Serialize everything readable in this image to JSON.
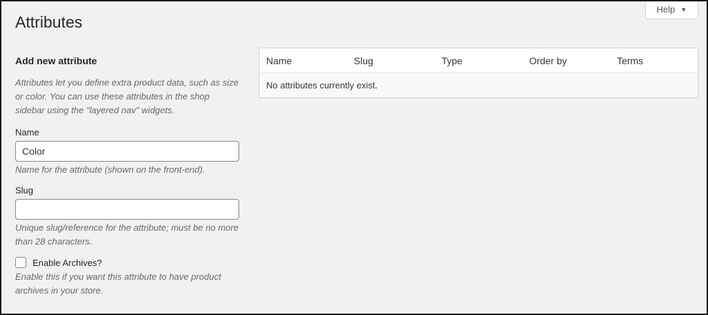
{
  "help": {
    "label": "Help"
  },
  "page_title": "Attributes",
  "form": {
    "heading": "Add new attribute",
    "intro": "Attributes let you define extra product data, such as size or color. You can use these attributes in the shop sidebar using the \"layered nav\" widgets.",
    "name": {
      "label": "Name",
      "value": "Color",
      "help": "Name for the attribute (shown on the front-end)."
    },
    "slug": {
      "label": "Slug",
      "value": "",
      "help": "Unique slug/reference for the attribute; must be no more than 28 characters."
    },
    "archives": {
      "label": "Enable Archives?",
      "checked": false,
      "help": "Enable this if you want this attribute to have product archives in your store."
    }
  },
  "table": {
    "columns": [
      "Name",
      "Slug",
      "Type",
      "Order by",
      "Terms"
    ],
    "empty_message": "No attributes currently exist."
  }
}
